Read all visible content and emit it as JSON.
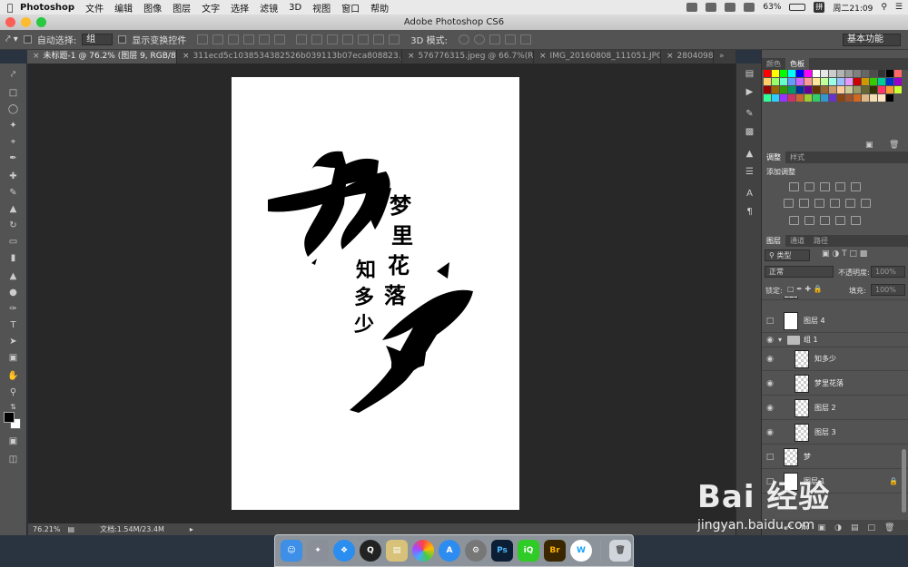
{
  "menubar": {
    "app_name": "Photoshop",
    "menus": [
      "文件",
      "编辑",
      "图像",
      "图层",
      "文字",
      "选择",
      "滤镜",
      "3D",
      "视图",
      "窗口",
      "帮助"
    ],
    "battery": "63%",
    "ime_label": "拼",
    "clock": "周二21:09"
  },
  "window": {
    "title": "Adobe Photoshop CS6"
  },
  "options": {
    "auto_select_label": "自动选择:",
    "auto_select_value": "组",
    "show_transform_label": "显示变换控件",
    "mode_3d_label": "3D 模式:",
    "workspace_label": "基本功能"
  },
  "tabs": [
    "未标题-1 @ 76.2% (图层 9, RGB/8) *",
    "311ecd5c10385343​82526b039113b07eca808823.jpg",
    "576776315.jpeg @ 66.7%(RG...",
    "IMG_20160808_111051.JPG ...",
    "2804098"
  ],
  "tab_overflow": "»",
  "status": {
    "zoom": "76.21%",
    "doc_size": "文档:1.54M/23.4M"
  },
  "artwork": {
    "char_big_top": "梦",
    "char_big_bottom": "梦",
    "vertical_1": [
      "梦",
      "里",
      "花",
      "落"
    ],
    "vertical_2": [
      "知",
      "多",
      "少"
    ]
  },
  "panels": {
    "color_tab": "颜色",
    "swatch_tab": "色板",
    "adjust_tab": "调整",
    "style_tab": "样式",
    "adjust_title": "添加调整",
    "layers_tab": "图层",
    "channels_tab": "通道",
    "paths_tab": "路径",
    "kind_filter": "类型",
    "blend_mode": "正常",
    "opacity_label": "不透明度:",
    "opacity_value": "100%",
    "lock_label": "锁定:",
    "fill_label": "填充:",
    "fill_value": "100%"
  },
  "layers": [
    {
      "name": "图层 4",
      "visible": false
    },
    {
      "name": "组 1",
      "visible": true
    },
    {
      "name": "知多少",
      "visible": true
    },
    {
      "name": "梦里花落",
      "visible": true
    },
    {
      "name": "图层 2",
      "visible": true
    },
    {
      "name": "图层 3",
      "visible": true
    },
    {
      "name": "梦",
      "visible": false
    },
    {
      "name": "图层 1",
      "visible": false
    }
  ],
  "swatch_colors": [
    "#ff0000",
    "#ffff00",
    "#00ff00",
    "#00ffff",
    "#0000ff",
    "#ff00ff",
    "#ffffff",
    "#e6e6e6",
    "#cccccc",
    "#b3b3b3",
    "#999999",
    "#808080",
    "#666666",
    "#4d4d4d",
    "#333333",
    "#000000",
    "#ff6666",
    "#ffcc66",
    "#99ff66",
    "#66ffcc",
    "#6699ff",
    "#cc66ff",
    "#ff9999",
    "#ffe599",
    "#c0ff99",
    "#99ffe5",
    "#99c0ff",
    "#e599ff",
    "#cc0000",
    "#cc9900",
    "#33cc00",
    "#00cc99",
    "#0033cc",
    "#9900cc",
    "#990000",
    "#996600",
    "#339900",
    "#009966",
    "#003399",
    "#660099",
    "#663300",
    "#996633",
    "#cc9966",
    "#ffcc99",
    "#cccc99",
    "#999966",
    "#666633",
    "#333300",
    "#ff3366",
    "#ff9933",
    "#ccff33",
    "#33ff99",
    "#33ccff",
    "#9933ff",
    "#cc3366",
    "#cc6633",
    "#99cc33",
    "#33cc66",
    "#3399cc",
    "#6633cc",
    "#8b4513",
    "#a0522d",
    "#d2691e",
    "#deb887",
    "#f5deb3",
    "#ffe4c4",
    "#000000"
  ],
  "dock_apps": [
    "Finder",
    "Launchpad",
    "Safari",
    "QQ",
    "Preview",
    "Photos",
    "App Store",
    "System Preferences",
    "Ps",
    "iQIYI",
    "Br",
    "W",
    "Trash"
  ],
  "watermark": {
    "logo": "Bai 经验",
    "url": "jingyan.baidu.com"
  }
}
